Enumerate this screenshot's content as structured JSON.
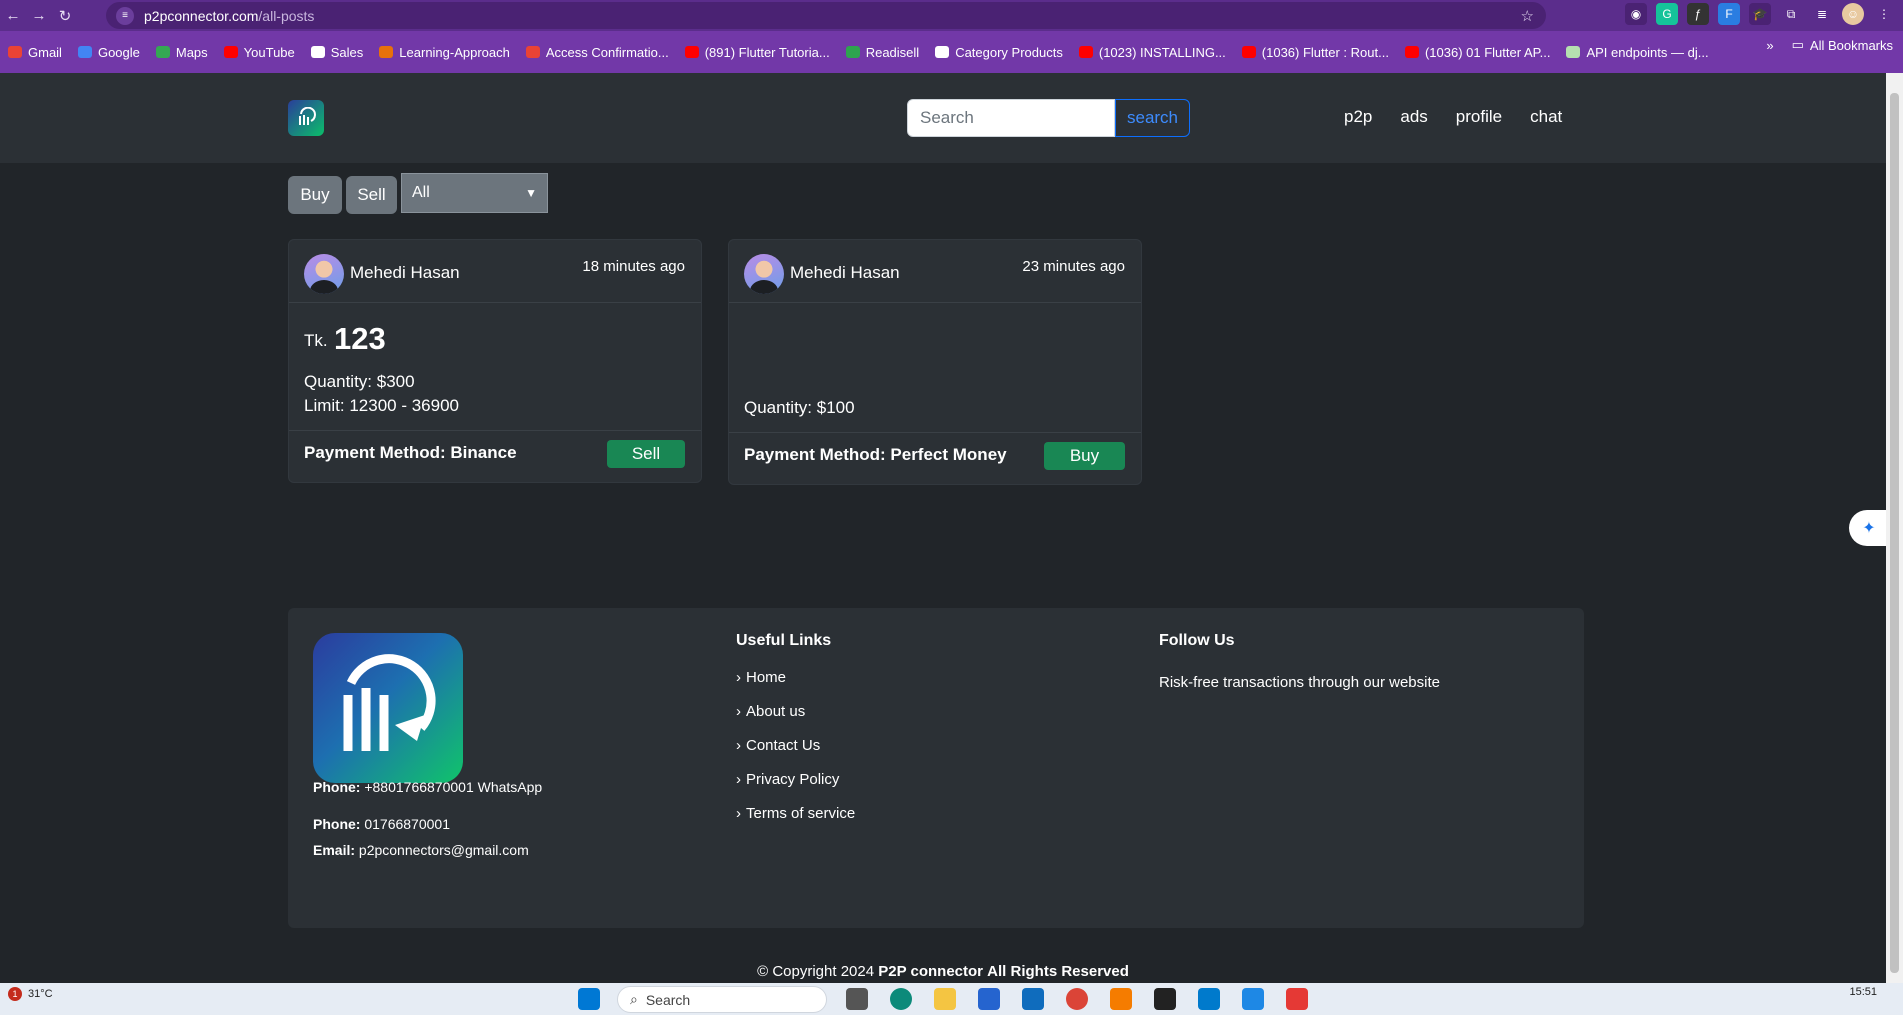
{
  "browser": {
    "url_host": "p2pconnector.com",
    "url_path": "/all-posts",
    "bookmarks": [
      {
        "label": "Gmail",
        "color": "#ea4335"
      },
      {
        "label": "Google",
        "color": "#4285f4"
      },
      {
        "label": "Maps",
        "color": "#34a853"
      },
      {
        "label": "YouTube",
        "color": "#ff0000"
      },
      {
        "label": "Sales",
        "color": "#ffffff"
      },
      {
        "label": "Learning-Approach",
        "color": "#e8710a"
      },
      {
        "label": "Access Confirmatio...",
        "color": "#ea4335"
      },
      {
        "label": "(891) Flutter Tutoria...",
        "color": "#ff0000"
      },
      {
        "label": "Readisell",
        "color": "#2ea44f"
      },
      {
        "label": "Category Products",
        "color": "#ffffff"
      },
      {
        "label": "(1023) INSTALLING...",
        "color": "#ff0000"
      },
      {
        "label": "(1036) Flutter : Rout...",
        "color": "#ff0000"
      },
      {
        "label": "(1036) 01 Flutter AP...",
        "color": "#ff0000"
      },
      {
        "label": "API endpoints — dj...",
        "color": "#b5e0b0"
      }
    ],
    "all_bookmarks_label": "All Bookmarks"
  },
  "header": {
    "search_placeholder": "Search",
    "search_button": "search",
    "nav": [
      "p2p",
      "ads",
      "profile",
      "chat"
    ]
  },
  "filters": {
    "buy_label": "Buy",
    "sell_label": "Sell",
    "select_value": "All"
  },
  "posts": [
    {
      "author": "Mehedi Hasan",
      "time": "18 minutes ago",
      "price_prefix": "Tk.",
      "price": "123",
      "quantity": "Quantity: $300",
      "limit": "Limit: 12300 - 36900",
      "payment": "Payment Method: Binance",
      "action": "Sell"
    },
    {
      "author": "Mehedi Hasan",
      "time": "23 minutes ago",
      "quantity": "Quantity: $100",
      "payment": "Payment Method: Perfect Money",
      "action": "Buy"
    }
  ],
  "footer": {
    "phone1_label": "Phone:",
    "phone1_value": "+8801766870001 WhatsApp",
    "phone2_label": "Phone:",
    "phone2_value": "01766870001",
    "email_label": "Email:",
    "email_value": "p2pconnectors@gmail.com",
    "useful_links_heading": "Useful Links",
    "useful_links": [
      "Home",
      "About us",
      "Contact Us",
      "Privacy Policy",
      "Terms of service"
    ],
    "follow_heading": "Follow Us",
    "follow_text": "Risk-free transactions through our website",
    "copyright_prefix": "© Copyright 2024",
    "copyright_brand": "P2P connector",
    "copyright_suffix": "All Rights Reserved"
  },
  "taskbar": {
    "weather_badge": "1",
    "temperature": "31°C",
    "search_label": "Search",
    "time": "15:51"
  },
  "colors": {
    "page_bg": "#212529",
    "panel_bg": "#2b3035",
    "accent_green": "#198754",
    "browser_purple": "#5b2d8c"
  }
}
